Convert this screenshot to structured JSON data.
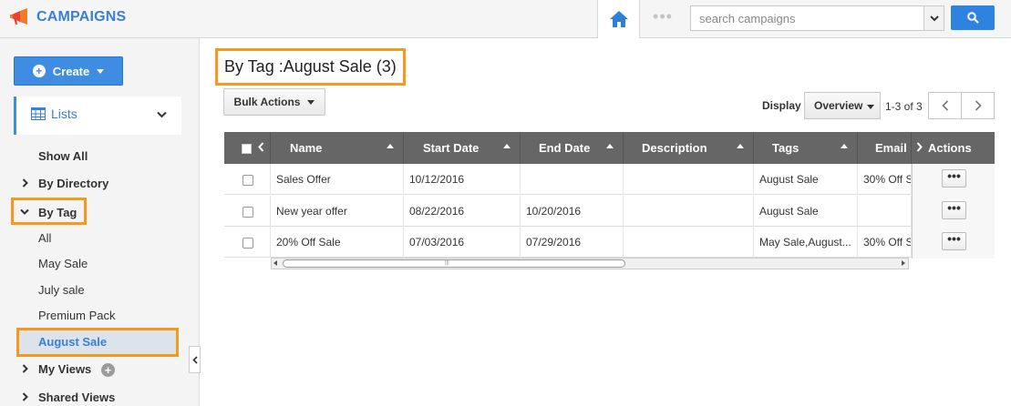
{
  "app": {
    "title": "CAMPAIGNS"
  },
  "search": {
    "placeholder": "search campaigns"
  },
  "sidebar": {
    "create_label": "Create",
    "lists_label": "Lists",
    "items": [
      {
        "label": "Show All"
      },
      {
        "label": "By Directory"
      },
      {
        "label": "By Tag"
      },
      {
        "label": "My Views"
      },
      {
        "label": "Shared Views"
      }
    ],
    "tags": [
      {
        "label": "All"
      },
      {
        "label": "May Sale"
      },
      {
        "label": "July sale"
      },
      {
        "label": "Premium Pack"
      },
      {
        "label": "August Sale"
      }
    ]
  },
  "main": {
    "title": "By Tag :August Sale (3)",
    "bulk_actions_label": "Bulk Actions",
    "display_label": "Display",
    "display_value": "Overview",
    "range_text": "1-3 of 3"
  },
  "table": {
    "columns": [
      "Name",
      "Start Date",
      "End Date",
      "Description",
      "Tags",
      "Email",
      "Actions"
    ],
    "rows": [
      {
        "name": "Sales Offer",
        "start": "10/12/2016",
        "end": "",
        "description": "",
        "tags": "August Sale",
        "email": "30% Off S"
      },
      {
        "name": "New year offer",
        "start": "08/22/2016",
        "end": "10/20/2016",
        "description": "",
        "tags": "August Sale",
        "email": ""
      },
      {
        "name": "20% Off Sale",
        "start": "07/03/2016",
        "end": "07/29/2016",
        "description": "",
        "tags": "May Sale,August...",
        "email": "30% Off S"
      }
    ],
    "action_button_label": "•••"
  },
  "colors": {
    "brand": "#3a7fd5",
    "highlight": "#f39a1f",
    "header_bg": "#666666",
    "button_blue": "#2f83e0"
  },
  "icons": [
    "megaphone-icon",
    "home-icon",
    "more-dots-icon",
    "chevron-down-icon",
    "search-icon",
    "plus-icon",
    "grid-list-icon",
    "chevron-right-icon",
    "chevron-left-icon"
  ]
}
